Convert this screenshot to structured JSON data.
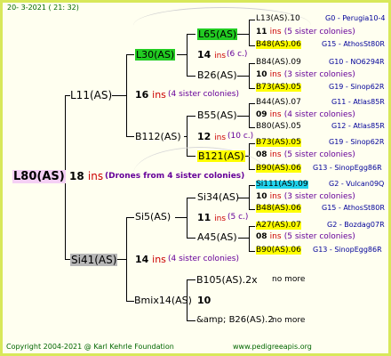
{
  "header": {
    "date": "20- 3-2021",
    "time": "( 21: 32)"
  },
  "root": {
    "name": "L80(AS)",
    "num": "18",
    "ins": "ins",
    "note": "(Drones from 4 sister colonies)"
  },
  "gen1": {
    "top": {
      "name": "L11(AS)",
      "num": "16",
      "ins": "ins",
      "note": "(4 sister colonies)"
    },
    "bottom": {
      "name": "Si41(AS)",
      "num": "14",
      "ins": "ins",
      "note": "(4 sister colonies)"
    }
  },
  "gen2": {
    "l30": {
      "name": "L30(AS)",
      "num": "14",
      "ins": "ins",
      "note": "(6 c.)"
    },
    "b112": {
      "name": "B112(AS)",
      "num": "12",
      "ins": "ins",
      "note": "(10 c.)"
    },
    "si5": {
      "name": "Si5(AS)",
      "num": "11",
      "ins": "ins",
      "note": "(5 c.)"
    },
    "bmix": {
      "name": "Bmix14(AS)",
      "num": "10"
    }
  },
  "gen3": {
    "l65": {
      "name": "L65(AS)",
      "num": "11",
      "ins": "ins",
      "note": "(5 sister colonies)"
    },
    "b26": {
      "name": "B26(AS)",
      "num": "10",
      "ins": "ins",
      "note": "(3 sister colonies)"
    },
    "b55": {
      "name": "B55(AS)",
      "num": "09",
      "ins": "ins",
      "note": "(4 sister colonies)"
    },
    "b121": {
      "name": "B121(AS)",
      "num": "08",
      "ins": "ins",
      "note": "(5 sister colonies)"
    },
    "si34": {
      "name": "Si34(AS)",
      "num": "10",
      "ins": "ins",
      "note": "(3 sister colonies)"
    },
    "a45": {
      "name": "A45(AS)",
      "num": "08",
      "ins": "ins",
      "note": "(5 sister colonies)"
    },
    "b105": {
      "name": "B105(AS).2x",
      "nomore": "no more"
    },
    "b26b": {
      "name": "&amp; B26(AS).2",
      "nomore": "no more"
    }
  },
  "gen4": [
    {
      "name": "L13(AS).10",
      "breeder": "G0 - Perugia10-4"
    },
    {
      "name": "B48(AS).06",
      "breeder": "G15 - AthosSt80R"
    },
    {
      "name": "B84(AS).09",
      "breeder": "G10 - NO6294R"
    },
    {
      "name": "B73(AS).05",
      "breeder": "G19 - Sinop62R"
    },
    {
      "name": "B44(AS).07",
      "breeder": "G11 - Atlas85R"
    },
    {
      "name": "B80(AS).05",
      "breeder": "G12 - Atlas85R"
    },
    {
      "name": "B73(AS).05",
      "breeder": "G19 - Sinop62R"
    },
    {
      "name": "B90(AS).06",
      "breeder": "G13 - SinopEgg86R"
    },
    {
      "name": "Si111(AS).09",
      "breeder": "G2 - Vulcan09Q"
    },
    {
      "name": "B48(AS).06",
      "breeder": "G15 - AthosSt80R"
    },
    {
      "name": "A27(AS).07",
      "breeder": "G2 - Bozdag07R"
    },
    {
      "name": "B90(AS).06",
      "breeder": "G13 - SinopEgg86R"
    }
  ],
  "footer": {
    "copyright": "Copyright 2004-2021 @ Karl Kehrle Foundation",
    "url": "www.pedigreeapis.org"
  },
  "colors": {
    "green": "#22cc22",
    "yellow": "#ffff00",
    "cyan": "#22d4ee",
    "gray": "#b8b8b8",
    "pink": "#f5d0f5",
    "ins": "#cc0000"
  }
}
